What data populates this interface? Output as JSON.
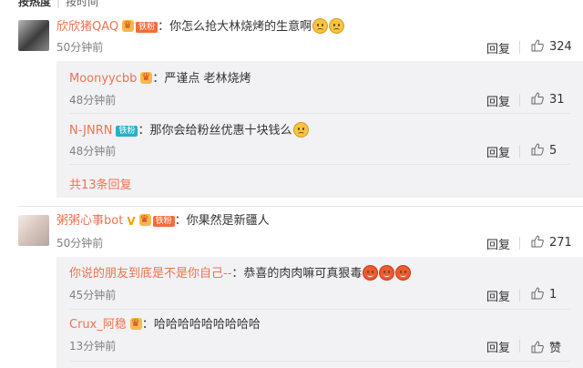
{
  "tabs": {
    "active": "按热度",
    "other": "按时间"
  },
  "threads": [
    {
      "username": "欣欣猪QAQ",
      "fan_badge": "铁粉",
      "text": "：你怎么抢大林烧烤的生意啊",
      "time": "50分钟前",
      "reply_label": "回复",
      "likes": "324",
      "replies": [
        {
          "username": "Moonyycbb",
          "text": "：严谨点 老林烧烤",
          "time": "48分钟前",
          "reply_label": "回复",
          "likes": "31"
        },
        {
          "username": "N-JNRN",
          "fan_badge": "铁粉",
          "text": "：那你会给粉丝优惠十块钱么",
          "time": "48分钟前",
          "reply_label": "回复",
          "likes": "5"
        }
      ],
      "more_replies": "共13条回复"
    },
    {
      "username": "粥粥心事bot",
      "fan_badge": "铁粉",
      "text": "：你果然是新疆人",
      "time": "50分钟前",
      "reply_label": "回复",
      "likes": "271",
      "replies": [
        {
          "username": "你说的朋友到底是不是你自己--",
          "text": "：恭喜的肉肉嘛可真狠毒",
          "time": "45分钟前",
          "reply_label": "回复",
          "likes": "1"
        },
        {
          "username": "Crux_阿稳",
          "text": "：哈哈哈哈哈哈哈哈哈",
          "time": "13分钟前",
          "reply_label": "回复",
          "likes": "赞"
        }
      ]
    }
  ],
  "icons": {
    "like": "thumbs-up-icon",
    "member": "crown-badge-icon",
    "verified": "v-badge-icon",
    "emoji_sad": "sad-face-emoji",
    "emoji_angry": "angry-face-emoji"
  },
  "colors": {
    "username": "#eb7350",
    "teal_badge": "#29b0c4",
    "orange_badge": "#f56b3c",
    "reply_bg": "#f2f2f5"
  }
}
